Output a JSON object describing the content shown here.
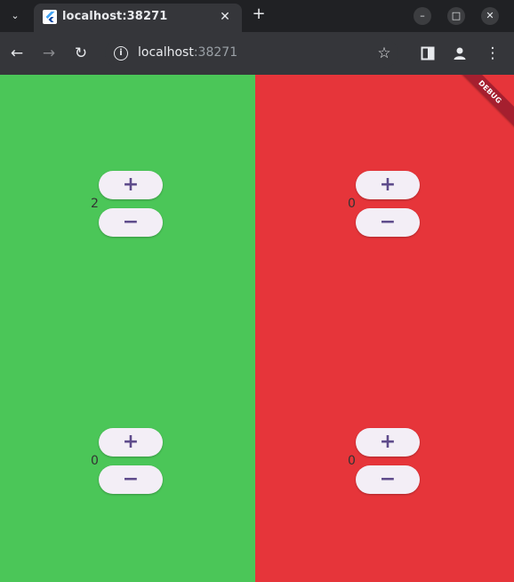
{
  "browser": {
    "tab_title": "localhost:38271",
    "url_host": "localhost",
    "url_port": ":38271"
  },
  "icons": {
    "tab_search": "chevron-down-icon",
    "tab_close": "close-icon",
    "new_tab": "plus-icon",
    "back": "arrow-left-icon",
    "forward": "arrow-right-icon",
    "reload": "reload-icon",
    "site_info": "info-icon",
    "bookmark": "star-icon",
    "side_panel": "side-panel-icon",
    "profile": "profile-icon",
    "menu": "more-vert-icon"
  },
  "colors": {
    "left_panel": "#4bc658",
    "right_panel": "#e6353a",
    "button_bg": "#f3eef6",
    "button_fg": "#5e4b8b"
  },
  "app": {
    "debug_banner": "DEBUG",
    "increment_label": "+",
    "decrement_label": "−",
    "counters": [
      {
        "value": "2"
      },
      {
        "value": "0"
      },
      {
        "value": "0"
      },
      {
        "value": "0"
      }
    ]
  }
}
